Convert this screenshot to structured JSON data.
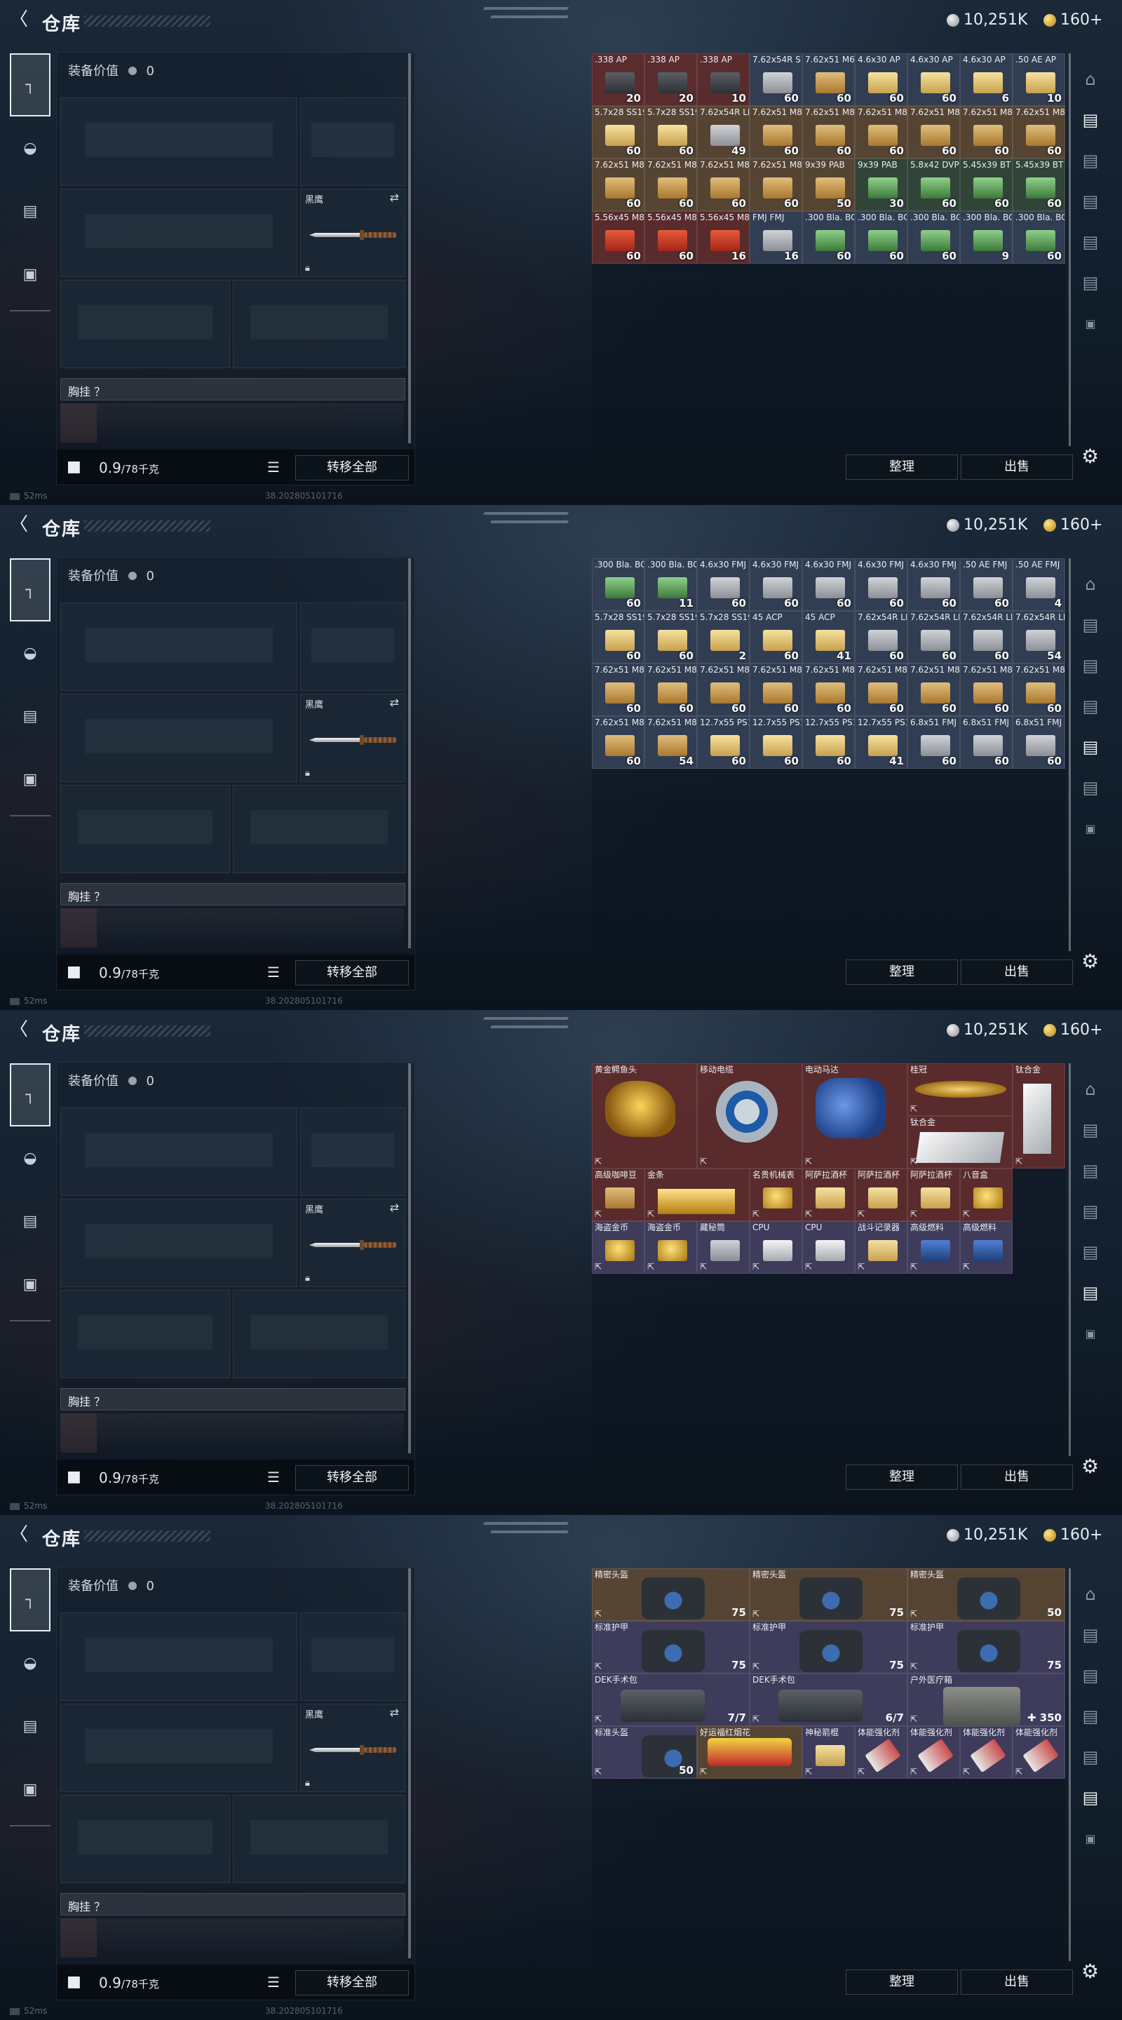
{
  "header": {
    "title": "仓库",
    "back_icon": "back-arrow-icon",
    "silver": "10,251K",
    "gold": "160+"
  },
  "loadout": {
    "gear_value_label": "装备价值",
    "gear_value": "0",
    "melee_name": "黑鹰",
    "rig_label": "胸挂 ？",
    "weight": "0.9",
    "weight_max": "/78千克",
    "transfer_all": "转移全部"
  },
  "stash": {
    "sort_label": "整理",
    "sell_label": "出售"
  },
  "status": {
    "ping": "52ms",
    "build": "38.202805101716"
  },
  "screens": [
    {
      "cells": [
        {
          "name": ".338 AP",
          "qty": "20",
          "bg": "red",
          "img": "dark"
        },
        {
          "name": ".338 AP",
          "qty": "20",
          "bg": "red",
          "img": "dark"
        },
        {
          "name": ".338 AP",
          "qty": "10",
          "bg": "red",
          "img": "dark"
        },
        {
          "name": "7.62x54R SNB",
          "qty": "60",
          "bg": "blue",
          "img": "grey"
        },
        {
          "name": "7.62x51 M61",
          "qty": "60",
          "bg": "blue",
          "img": "box"
        },
        {
          "name": "4.6x30 AP",
          "qty": "60",
          "bg": "blue",
          "img": "yellow"
        },
        {
          "name": "4.6x30 AP",
          "qty": "60",
          "bg": "blue",
          "img": "yellow"
        },
        {
          "name": "4.6x30 AP",
          "qty": "6",
          "bg": "blue",
          "img": "yellow"
        },
        {
          "name": ".50 AE AP",
          "qty": "10",
          "bg": "blue",
          "img": "yellow"
        },
        {
          "name": "5.7x28 SS190",
          "qty": "60",
          "bg": "gold",
          "img": "yellow"
        },
        {
          "name": "5.7x28 SS190",
          "qty": "60",
          "bg": "gold",
          "img": "yellow"
        },
        {
          "name": "7.62x54R LPS",
          "qty": "49",
          "bg": "gold",
          "img": "grey"
        },
        {
          "name": "7.62x51 M80",
          "qty": "60",
          "bg": "gold",
          "img": "box"
        },
        {
          "name": "7.62x51 M80",
          "qty": "60",
          "bg": "gold",
          "img": "box"
        },
        {
          "name": "7.62x51 M80",
          "qty": "60",
          "bg": "gold",
          "img": "box"
        },
        {
          "name": "7.62x51 M80",
          "qty": "60",
          "bg": "gold",
          "img": "box"
        },
        {
          "name": "7.62x51 M80",
          "qty": "60",
          "bg": "gold",
          "img": "box"
        },
        {
          "name": "7.62x51 M80",
          "qty": "60",
          "bg": "gold",
          "img": "box"
        },
        {
          "name": "7.62x51 M80",
          "qty": "60",
          "bg": "gold",
          "img": "box"
        },
        {
          "name": "7.62x51 M80",
          "qty": "60",
          "bg": "gold",
          "img": "box"
        },
        {
          "name": "7.62x51 M80",
          "qty": "60",
          "bg": "gold",
          "img": "box"
        },
        {
          "name": "7.62x51 M80",
          "qty": "60",
          "bg": "gold",
          "img": "box"
        },
        {
          "name": "9x39 PAB",
          "qty": "50",
          "bg": "gold",
          "img": "box"
        },
        {
          "name": "9x39 PAB",
          "qty": "30",
          "bg": "green",
          "img": "green"
        },
        {
          "name": "5.8x42 DVP",
          "qty": "60",
          "bg": "green",
          "img": "green"
        },
        {
          "name": "5.45x39 BT",
          "qty": "60",
          "bg": "green",
          "img": "green"
        },
        {
          "name": "5.45x39 BT",
          "qty": "60",
          "bg": "green",
          "img": "green"
        },
        {
          "name": "5.56x45 M855",
          "qty": "60",
          "bg": "red",
          "img": "red"
        },
        {
          "name": "5.56x45 M855",
          "qty": "60",
          "bg": "red",
          "img": "red"
        },
        {
          "name": "5.56x45 M855",
          "qty": "16",
          "bg": "red",
          "img": "red"
        },
        {
          "name": "FMJ FMJ",
          "qty": "16",
          "bg": "blue",
          "img": "grey"
        },
        {
          "name": ".300 Bla. BCP FMJ",
          "qty": "60",
          "bg": "blue",
          "img": "green"
        },
        {
          "name": ".300 Bla. BCP FMJ",
          "qty": "60",
          "bg": "blue",
          "img": "green"
        },
        {
          "name": ".300 Bla. BCP FMJ",
          "qty": "60",
          "bg": "blue",
          "img": "green"
        },
        {
          "name": ".300 Bla. BCP FMJ",
          "qty": "9",
          "bg": "blue",
          "img": "green"
        },
        {
          "name": ".300 Bla. BCP FMJ",
          "qty": "60",
          "bg": "blue",
          "img": "green"
        }
      ]
    },
    {
      "cells": [
        {
          "name": ".300 Bla. BCP FMJ",
          "qty": "60",
          "bg": "blue",
          "img": "green"
        },
        {
          "name": ".300 Bla. BCP FMJ",
          "qty": "11",
          "bg": "blue",
          "img": "green"
        },
        {
          "name": "4.6x30 FMJ",
          "qty": "60",
          "bg": "blue",
          "img": "grey"
        },
        {
          "name": "4.6x30 FMJ",
          "qty": "60",
          "bg": "blue",
          "img": "grey"
        },
        {
          "name": "4.6x30 FMJ",
          "qty": "60",
          "bg": "blue",
          "img": "grey"
        },
        {
          "name": "4.6x30 FMJ",
          "qty": "60",
          "bg": "blue",
          "img": "grey"
        },
        {
          "name": "4.6x30 FMJ",
          "qty": "60",
          "bg": "blue",
          "img": "grey"
        },
        {
          "name": ".50 AE FMJ",
          "qty": "60",
          "bg": "blue",
          "img": "grey"
        },
        {
          "name": ".50 AE FMJ",
          "qty": "4",
          "bg": "blue",
          "img": "grey"
        },
        {
          "name": "5.7x28 SS198",
          "qty": "60",
          "bg": "blue",
          "img": "yellow"
        },
        {
          "name": "5.7x28 SS198",
          "qty": "60",
          "bg": "blue",
          "img": "yellow"
        },
        {
          "name": "5.7x28 SS198",
          "qty": "2",
          "bg": "blue",
          "img": "yellow"
        },
        {
          "name": "45 ACP",
          "qty": "60",
          "bg": "blue",
          "img": "yellow"
        },
        {
          "name": "45 ACP",
          "qty": "41",
          "bg": "blue",
          "img": "yellow"
        },
        {
          "name": "7.62x54R LPS",
          "qty": "60",
          "bg": "blue",
          "img": "grey"
        },
        {
          "name": "7.62x54R LPS",
          "qty": "60",
          "bg": "blue",
          "img": "grey"
        },
        {
          "name": "7.62x54R LPS",
          "qty": "60",
          "bg": "blue",
          "img": "grey"
        },
        {
          "name": "7.62x54R LPS",
          "qty": "54",
          "bg": "blue",
          "img": "grey"
        },
        {
          "name": "7.62x51 M80",
          "qty": "60",
          "bg": "blue",
          "img": "box"
        },
        {
          "name": "7.62x51 M80",
          "qty": "60",
          "bg": "blue",
          "img": "box"
        },
        {
          "name": "7.62x51 M80",
          "qty": "60",
          "bg": "blue",
          "img": "box"
        },
        {
          "name": "7.62x51 M80",
          "qty": "60",
          "bg": "blue",
          "img": "box"
        },
        {
          "name": "7.62x51 M80",
          "qty": "60",
          "bg": "blue",
          "img": "box"
        },
        {
          "name": "7.62x51 M80",
          "qty": "60",
          "bg": "blue",
          "img": "box"
        },
        {
          "name": "7.62x51 M80",
          "qty": "60",
          "bg": "blue",
          "img": "box"
        },
        {
          "name": "7.62x51 M80",
          "qty": "60",
          "bg": "blue",
          "img": "box"
        },
        {
          "name": "7.62x51 M80",
          "qty": "60",
          "bg": "blue",
          "img": "box"
        },
        {
          "name": "7.62x51 M80",
          "qty": "60",
          "bg": "blue",
          "img": "box"
        },
        {
          "name": "7.62x51 M80",
          "qty": "54",
          "bg": "blue",
          "img": "box"
        },
        {
          "name": "12.7x55 PS12A",
          "qty": "60",
          "bg": "blue",
          "img": "yellow"
        },
        {
          "name": "12.7x55 PS12A",
          "qty": "60",
          "bg": "blue",
          "img": "yellow"
        },
        {
          "name": "12.7x55 PS12A",
          "qty": "60",
          "bg": "blue",
          "img": "yellow"
        },
        {
          "name": "12.7x55 PS12A",
          "qty": "41",
          "bg": "blue",
          "img": "yellow"
        },
        {
          "name": "6.8x51 FMJ",
          "qty": "60",
          "bg": "blue",
          "img": "grey"
        },
        {
          "name": "6.8x51 FMJ",
          "qty": "60",
          "bg": "blue",
          "img": "grey"
        },
        {
          "name": "6.8x51 FMJ",
          "qty": "60",
          "bg": "blue",
          "img": "grey"
        }
      ]
    },
    {
      "items": [
        {
          "name": "黄金鳄鱼头",
          "art": "hood",
          "bg": "red",
          "col": 1,
          "row": 1,
          "cs": 2,
          "rs": 2
        },
        {
          "name": "移动电缆",
          "art": "reel",
          "bg": "red",
          "col": 3,
          "row": 1,
          "cs": 2,
          "rs": 2
        },
        {
          "name": "电动马达",
          "art": "motor",
          "bg": "red",
          "col": 5,
          "row": 1,
          "cs": 2,
          "rs": 2
        },
        {
          "name": "桂冠",
          "art": "crown",
          "bg": "red",
          "col": 7,
          "row": 1,
          "cs": 2,
          "rs": 1
        },
        {
          "name": "钛合金",
          "art": "plate",
          "bg": "red",
          "col": 9,
          "row": 1,
          "cs": 1,
          "rs": 2
        },
        {
          "name": "钛合金",
          "art": "plate-wide",
          "bg": "red",
          "col": 7,
          "row": 2,
          "cs": 2,
          "rs": 1
        },
        {
          "name": "高级咖啡豆",
          "art": "box",
          "bg": "red",
          "col": 1,
          "row": 3,
          "cs": 1,
          "rs": 1
        },
        {
          "name": "金条",
          "art": "goldbar",
          "bg": "red",
          "col": 2,
          "row": 3,
          "cs": 2,
          "rs": 1
        },
        {
          "name": "名贵机械表",
          "art": "gold",
          "bg": "red",
          "col": 4,
          "row": 3,
          "cs": 1,
          "rs": 1
        },
        {
          "name": "阿萨拉酒杯",
          "art": "yellow",
          "bg": "red",
          "col": 5,
          "row": 3,
          "cs": 1,
          "rs": 1
        },
        {
          "name": "阿萨拉酒杯",
          "art": "yellow",
          "bg": "red",
          "col": 6,
          "row": 3,
          "cs": 1,
          "rs": 1
        },
        {
          "name": "阿萨拉酒杯",
          "art": "yellow",
          "bg": "red",
          "col": 7,
          "row": 3,
          "cs": 1,
          "rs": 1
        },
        {
          "name": "八音盒",
          "art": "gold",
          "bg": "red",
          "col": 8,
          "row": 3,
          "cs": 1,
          "rs": 1
        },
        {
          "name": "海盗金币",
          "art": "gold",
          "bg": "purple",
          "col": 1,
          "row": 4,
          "cs": 1,
          "rs": 1
        },
        {
          "name": "海盗金币",
          "art": "gold",
          "bg": "purple",
          "col": 2,
          "row": 4,
          "cs": 1,
          "rs": 1
        },
        {
          "name": "藏秘筒",
          "art": "grey",
          "bg": "purple",
          "col": 3,
          "row": 4,
          "cs": 1,
          "rs": 1
        },
        {
          "name": "CPU",
          "art": "white",
          "bg": "purple",
          "col": 4,
          "row": 4,
          "cs": 1,
          "rs": 1
        },
        {
          "name": "CPU",
          "art": "white",
          "bg": "purple",
          "col": 5,
          "row": 4,
          "cs": 1,
          "rs": 1
        },
        {
          "name": "战斗记录器",
          "art": "yellow",
          "bg": "purple",
          "col": 6,
          "row": 4,
          "cs": 1,
          "rs": 1
        },
        {
          "name": "高级燃料",
          "art": "blue",
          "bg": "purple",
          "col": 7,
          "row": 4,
          "cs": 1,
          "rs": 1
        },
        {
          "name": "高级燃料",
          "art": "blue",
          "bg": "purple",
          "col": 8,
          "row": 4,
          "cs": 1,
          "rs": 1
        }
      ]
    },
    {
      "items": [
        {
          "name": "精密头盔",
          "art": "bigbag",
          "bg": "gold",
          "col": 1,
          "row": 1,
          "cs": 3,
          "rs": 1,
          "qty": "75"
        },
        {
          "name": "精密头盔",
          "art": "bigbag",
          "bg": "gold",
          "col": 4,
          "row": 1,
          "cs": 3,
          "rs": 1,
          "qty": "75"
        },
        {
          "name": "精密头盔",
          "art": "bigbag",
          "bg": "gold",
          "col": 7,
          "row": 1,
          "cs": 3,
          "rs": 1,
          "qty": "50"
        },
        {
          "name": "标准护甲",
          "art": "bigbag",
          "bg": "purple",
          "col": 1,
          "row": 2,
          "cs": 3,
          "rs": 1,
          "qty": "75"
        },
        {
          "name": "标准护甲",
          "art": "bigbag",
          "bg": "purple",
          "col": 4,
          "row": 2,
          "cs": 3,
          "rs": 1,
          "qty": "75"
        },
        {
          "name": "标准护甲",
          "art": "bigbag",
          "bg": "purple",
          "col": 7,
          "row": 2,
          "cs": 3,
          "rs": 1,
          "qty": "75"
        },
        {
          "name": "DEK手术包",
          "art": "bigcase",
          "bg": "purple",
          "col": 1,
          "row": 3,
          "cs": 3,
          "rs": 1,
          "qty": "7/7"
        },
        {
          "name": "DEK手术包",
          "art": "bigcase",
          "bg": "purple",
          "col": 4,
          "row": 3,
          "cs": 3,
          "rs": 1,
          "qty": "6/7"
        },
        {
          "name": "户外医疗箱",
          "art": "medkit",
          "bg": "purple",
          "col": 7,
          "row": 3,
          "cs": 3,
          "rs": 1,
          "qty": "✚ 350"
        },
        {
          "name": "标准头盔",
          "art": "bigbag",
          "bg": "purple",
          "col": 1,
          "row": 4,
          "cs": 2,
          "rs": 1,
          "qty": "50"
        },
        {
          "name": "好运福红烟花",
          "art": "redpack",
          "bg": "gold",
          "col": 3,
          "row": 4,
          "cs": 2,
          "rs": 1,
          "qty": ""
        },
        {
          "name": "神秘箭棍",
          "art": "yellow",
          "bg": "purple",
          "col": 5,
          "row": 4,
          "cs": 1,
          "rs": 1,
          "qty": ""
        },
        {
          "name": "体能强化剂",
          "art": "syringe",
          "bg": "purple",
          "col": 6,
          "row": 4,
          "cs": 1,
          "rs": 1,
          "qty": ""
        },
        {
          "name": "体能强化剂",
          "art": "syringe",
          "bg": "purple",
          "col": 7,
          "row": 4,
          "cs": 1,
          "rs": 1,
          "qty": ""
        },
        {
          "name": "体能强化剂",
          "art": "syringe",
          "bg": "purple",
          "col": 8,
          "row": 4,
          "cs": 1,
          "rs": 1,
          "qty": ""
        },
        {
          "name": "体能强化剂",
          "art": "syringe",
          "bg": "purple",
          "col": 9,
          "row": 4,
          "cs": 1,
          "rs": 1,
          "qty": ""
        }
      ]
    }
  ],
  "icons": {
    "left_tabs": [
      "pistol-icon",
      "helmet-icon",
      "vest-icon",
      "briefcase-icon"
    ],
    "right_nav": [
      "dome-icon",
      "stash-tab-icon",
      "stash-tab-icon",
      "stash-tab-icon",
      "stash-tab-add-icon",
      "stash-tab-add-icon",
      "lock-icon"
    ]
  }
}
